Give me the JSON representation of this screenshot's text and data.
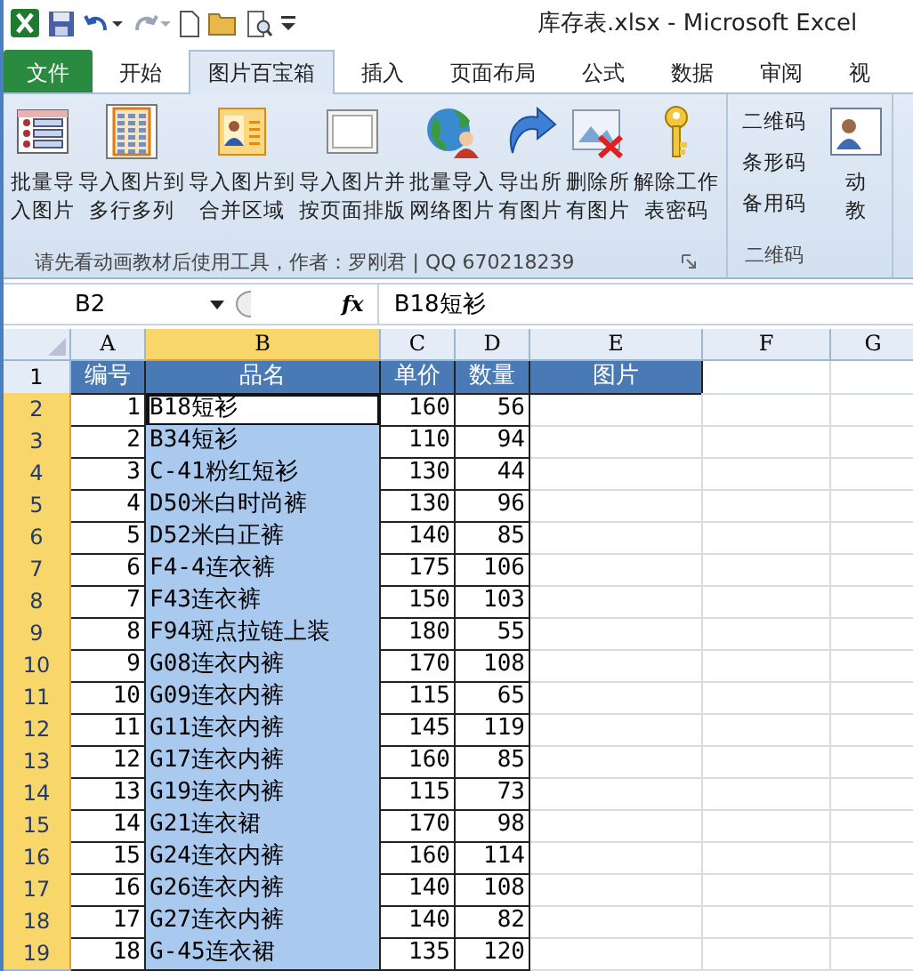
{
  "window": {
    "title": "库存表.xlsx  -  Microsoft Excel"
  },
  "tabs": [
    {
      "label": "文件",
      "kind": "file",
      "selected": false
    },
    {
      "label": "开始",
      "kind": "tab",
      "selected": false
    },
    {
      "label": "图片百宝箱",
      "kind": "tab",
      "selected": true
    },
    {
      "label": "插入",
      "kind": "tab",
      "selected": false
    },
    {
      "label": "页面布局",
      "kind": "tab",
      "selected": false
    },
    {
      "label": "公式",
      "kind": "tab",
      "selected": false
    },
    {
      "label": "数据",
      "kind": "tab",
      "selected": false
    },
    {
      "label": "审阅",
      "kind": "tab",
      "selected": false
    },
    {
      "label": "视",
      "kind": "tab",
      "selected": false
    }
  ],
  "ribbon": {
    "groups": [
      {
        "kind": "large",
        "label": "请先看动画教材后使用工具，作者：罗刚君 | QQ 670218239",
        "buttons": [
          {
            "lines": [
              "批量导",
              "入图片"
            ]
          },
          {
            "lines": [
              "导入图片到",
              "多行多列"
            ]
          },
          {
            "lines": [
              "导入图片到",
              "合并区域"
            ]
          },
          {
            "lines": [
              "导入图片并",
              "按页面排版"
            ]
          },
          {
            "lines": [
              "批量导入",
              "网络图片"
            ]
          },
          {
            "lines": [
              "导出所",
              "有图片"
            ]
          },
          {
            "lines": [
              "删除所",
              "有图片"
            ]
          },
          {
            "lines": [
              "解除工作",
              "表密码"
            ]
          }
        ]
      },
      {
        "kind": "small",
        "label": "二维码",
        "buttons": [
          {
            "lines": [
              "二维码"
            ]
          },
          {
            "lines": [
              "条形码"
            ]
          },
          {
            "lines": [
              "备用码"
            ]
          }
        ]
      },
      {
        "kind": "large",
        "buttons": [
          {
            "lines": [
              "动",
              "教"
            ]
          }
        ]
      }
    ]
  },
  "formula_bar": {
    "name_box": "B2",
    "function_symbol": "fx",
    "formula": "B18短衫"
  },
  "columns": [
    {
      "label": "A",
      "selected": false
    },
    {
      "label": "B",
      "selected": true
    },
    {
      "label": "C",
      "selected": false
    },
    {
      "label": "D",
      "selected": false
    },
    {
      "label": "E",
      "selected": false
    },
    {
      "label": "F",
      "selected": false
    },
    {
      "label": "G",
      "selected": false
    }
  ],
  "rows": [
    {
      "num": "1",
      "kind": "header",
      "selected": false,
      "active": false,
      "cells": [
        "编号",
        "品名",
        "单价",
        "数量",
        "图片"
      ]
    },
    {
      "num": "2",
      "kind": "data",
      "selected": true,
      "active": true,
      "cells": [
        "1",
        "B18短衫",
        "160",
        "56"
      ]
    },
    {
      "num": "3",
      "kind": "data",
      "selected": true,
      "active": false,
      "cells": [
        "2",
        "B34短衫",
        "110",
        "94"
      ]
    },
    {
      "num": "4",
      "kind": "data",
      "selected": true,
      "active": false,
      "cells": [
        "3",
        "C-41粉红短衫",
        "130",
        "44"
      ]
    },
    {
      "num": "5",
      "kind": "data",
      "selected": true,
      "active": false,
      "cells": [
        "4",
        "D50米白时尚裤",
        "130",
        "96"
      ]
    },
    {
      "num": "6",
      "kind": "data",
      "selected": true,
      "active": false,
      "cells": [
        "5",
        "D52米白正裤",
        "140",
        "85"
      ]
    },
    {
      "num": "7",
      "kind": "data",
      "selected": true,
      "active": false,
      "cells": [
        "6",
        "F4-4连衣裤",
        "175",
        "106"
      ]
    },
    {
      "num": "8",
      "kind": "data",
      "selected": true,
      "active": false,
      "cells": [
        "7",
        "F43连衣裤",
        "150",
        "103"
      ]
    },
    {
      "num": "9",
      "kind": "data",
      "selected": true,
      "active": false,
      "cells": [
        "8",
        "F94斑点拉链上装",
        "180",
        "55"
      ]
    },
    {
      "num": "10",
      "kind": "data",
      "selected": true,
      "active": false,
      "cells": [
        "9",
        "G08连衣内裤",
        "170",
        "108"
      ]
    },
    {
      "num": "11",
      "kind": "data",
      "selected": true,
      "active": false,
      "cells": [
        "10",
        "G09连衣内裤",
        "115",
        "65"
      ]
    },
    {
      "num": "12",
      "kind": "data",
      "selected": true,
      "active": false,
      "cells": [
        "11",
        "G11连衣内裤",
        "145",
        "119"
      ]
    },
    {
      "num": "13",
      "kind": "data",
      "selected": true,
      "active": false,
      "cells": [
        "12",
        "G17连衣内裤",
        "160",
        "85"
      ]
    },
    {
      "num": "14",
      "kind": "data",
      "selected": true,
      "active": false,
      "cells": [
        "13",
        "G19连衣内裤",
        "115",
        "73"
      ]
    },
    {
      "num": "15",
      "kind": "data",
      "selected": true,
      "active": false,
      "cells": [
        "14",
        "G21连衣裙",
        "170",
        "98"
      ]
    },
    {
      "num": "16",
      "kind": "data",
      "selected": true,
      "active": false,
      "cells": [
        "15",
        "G24连衣内裤",
        "160",
        "114"
      ]
    },
    {
      "num": "17",
      "kind": "data",
      "selected": true,
      "active": false,
      "cells": [
        "16",
        "G26连衣内裤",
        "140",
        "108"
      ]
    },
    {
      "num": "18",
      "kind": "data",
      "selected": true,
      "active": false,
      "cells": [
        "17",
        "G27连衣内裤",
        "140",
        "82"
      ]
    },
    {
      "num": "19",
      "kind": "data",
      "selected": true,
      "active": false,
      "cells": [
        "18",
        "G-45连衣裙",
        "135",
        "120"
      ]
    }
  ]
}
